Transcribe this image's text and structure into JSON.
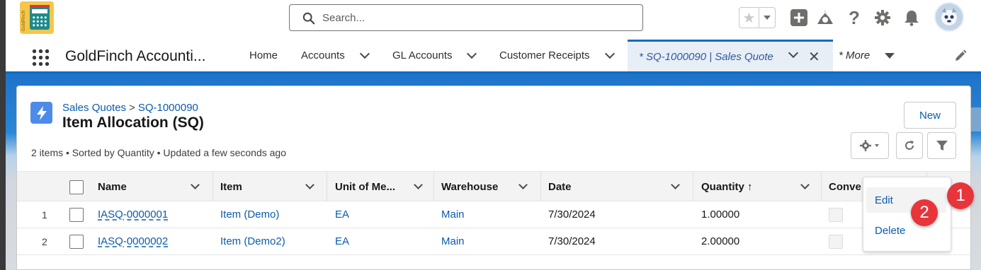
{
  "app_logo": {
    "label": "GoldFinch"
  },
  "search": {
    "placeholder": "Search..."
  },
  "header_icons": [
    "star-icon",
    "add-icon",
    "trailhead-icon",
    "help-icon",
    "setup-gear-icon",
    "notifications-bell-icon",
    "avatar"
  ],
  "nav": {
    "app_name": "GoldFinch Accounti...",
    "items": [
      {
        "label": "Home"
      },
      {
        "label": "Accounts"
      },
      {
        "label": "GL Accounts"
      },
      {
        "label": "Customer Receipts"
      }
    ],
    "active_tab": "* SQ-1000090 | Sales Quote",
    "more": "* More"
  },
  "list": {
    "breadcrumb_parent": "Sales Quotes",
    "breadcrumb_sep": ">",
    "breadcrumb_record": "SQ-1000090",
    "title": "Item Allocation (SQ)",
    "meta": "2 items • Sorted by Quantity • Updated a few seconds ago",
    "new_button": "New"
  },
  "table": {
    "columns": [
      "Name",
      "Item",
      "Unit of Me...",
      "Warehouse",
      "Date",
      "Quantity ↑",
      "Conve"
    ],
    "rows": [
      {
        "num": "1",
        "name": "IASQ-0000001",
        "item": "Item (Demo)",
        "uom": "EA",
        "warehouse": "Main",
        "date": "7/30/2024",
        "quantity": "1.00000"
      },
      {
        "num": "2",
        "name": "IASQ-0000002",
        "item": "Item (Demo2)",
        "uom": "EA",
        "warehouse": "Main",
        "date": "7/30/2024",
        "quantity": "2.00000"
      }
    ]
  },
  "row_menu": {
    "edit": "Edit",
    "delete": "Delete"
  },
  "annotations": {
    "badge1": "1",
    "badge2": "2"
  },
  "colors": {
    "brand_blue": "#0b6cc4",
    "link": "#0b5cab",
    "badge_red": "#e8343b"
  }
}
